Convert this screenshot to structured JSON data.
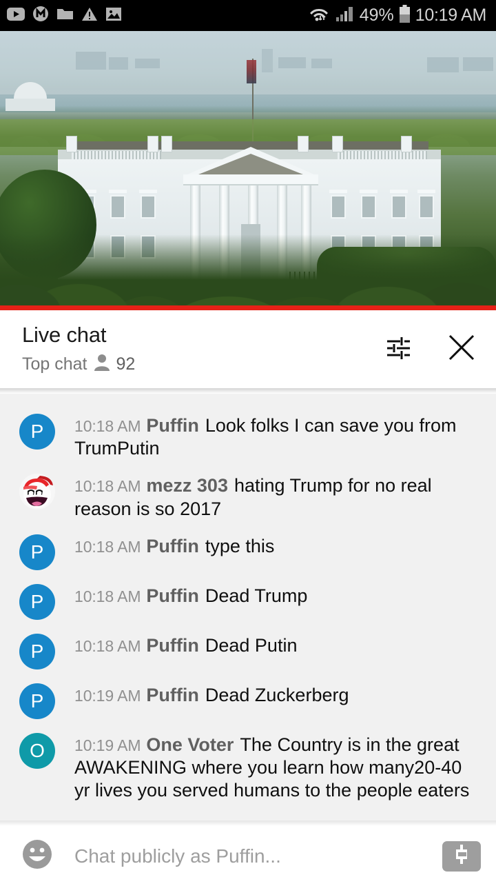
{
  "statusbar": {
    "icons": [
      "youtube-icon",
      "messenger-icon",
      "folder-icon",
      "warning-icon",
      "image-icon"
    ],
    "wifi_icon": "wifi-icon",
    "signal_icon": "cellular-signal-icon",
    "battery_percent": "49%",
    "battery_icon": "battery-icon",
    "time": "10:19 AM"
  },
  "video": {
    "scene": "white-house-live-stream",
    "progress_color": "#e62117",
    "progress_percent": 100
  },
  "chat_header": {
    "title": "Live chat",
    "subtitle": "Top chat",
    "viewer_icon": "person-icon",
    "viewer_count": "92",
    "settings_icon": "tune-icon",
    "close_icon": "close-icon"
  },
  "messages": [
    {
      "time": "10:18 AM",
      "author": "Puffin",
      "text": "Look folks I can save you from TrumPutin",
      "avatar_type": "letter",
      "avatar_letter": "P",
      "avatar_color": "#1787c9"
    },
    {
      "time": "10:18 AM",
      "author": "mezz 303",
      "text": "hating Trump for no real reason is so 2017",
      "avatar_type": "image",
      "avatar_letter": "",
      "avatar_color": "#f6f6f6"
    },
    {
      "time": "10:18 AM",
      "author": "Puffin",
      "text": "type this",
      "avatar_type": "letter",
      "avatar_letter": "P",
      "avatar_color": "#1787c9"
    },
    {
      "time": "10:18 AM",
      "author": "Puffin",
      "text": "Dead Trump",
      "avatar_type": "letter",
      "avatar_letter": "P",
      "avatar_color": "#1787c9"
    },
    {
      "time": "10:18 AM",
      "author": "Puffin",
      "text": "Dead Putin",
      "avatar_type": "letter",
      "avatar_letter": "P",
      "avatar_color": "#1787c9"
    },
    {
      "time": "10:19 AM",
      "author": "Puffin",
      "text": "Dead Zuckerberg",
      "avatar_type": "letter",
      "avatar_letter": "P",
      "avatar_color": "#1787c9"
    },
    {
      "time": "10:19 AM",
      "author": "One Voter",
      "text": "The Country is in the great AWAKENING where you learn how many20-40 yr lives you served humans to the people eaters",
      "avatar_type": "letter",
      "avatar_letter": "O",
      "avatar_color": "#0f9aa8"
    }
  ],
  "input_bar": {
    "emoji_icon": "emoji-icon",
    "placeholder": "Chat publicly as Puffin...",
    "value": "",
    "superchat_icon": "dollar-icon"
  }
}
